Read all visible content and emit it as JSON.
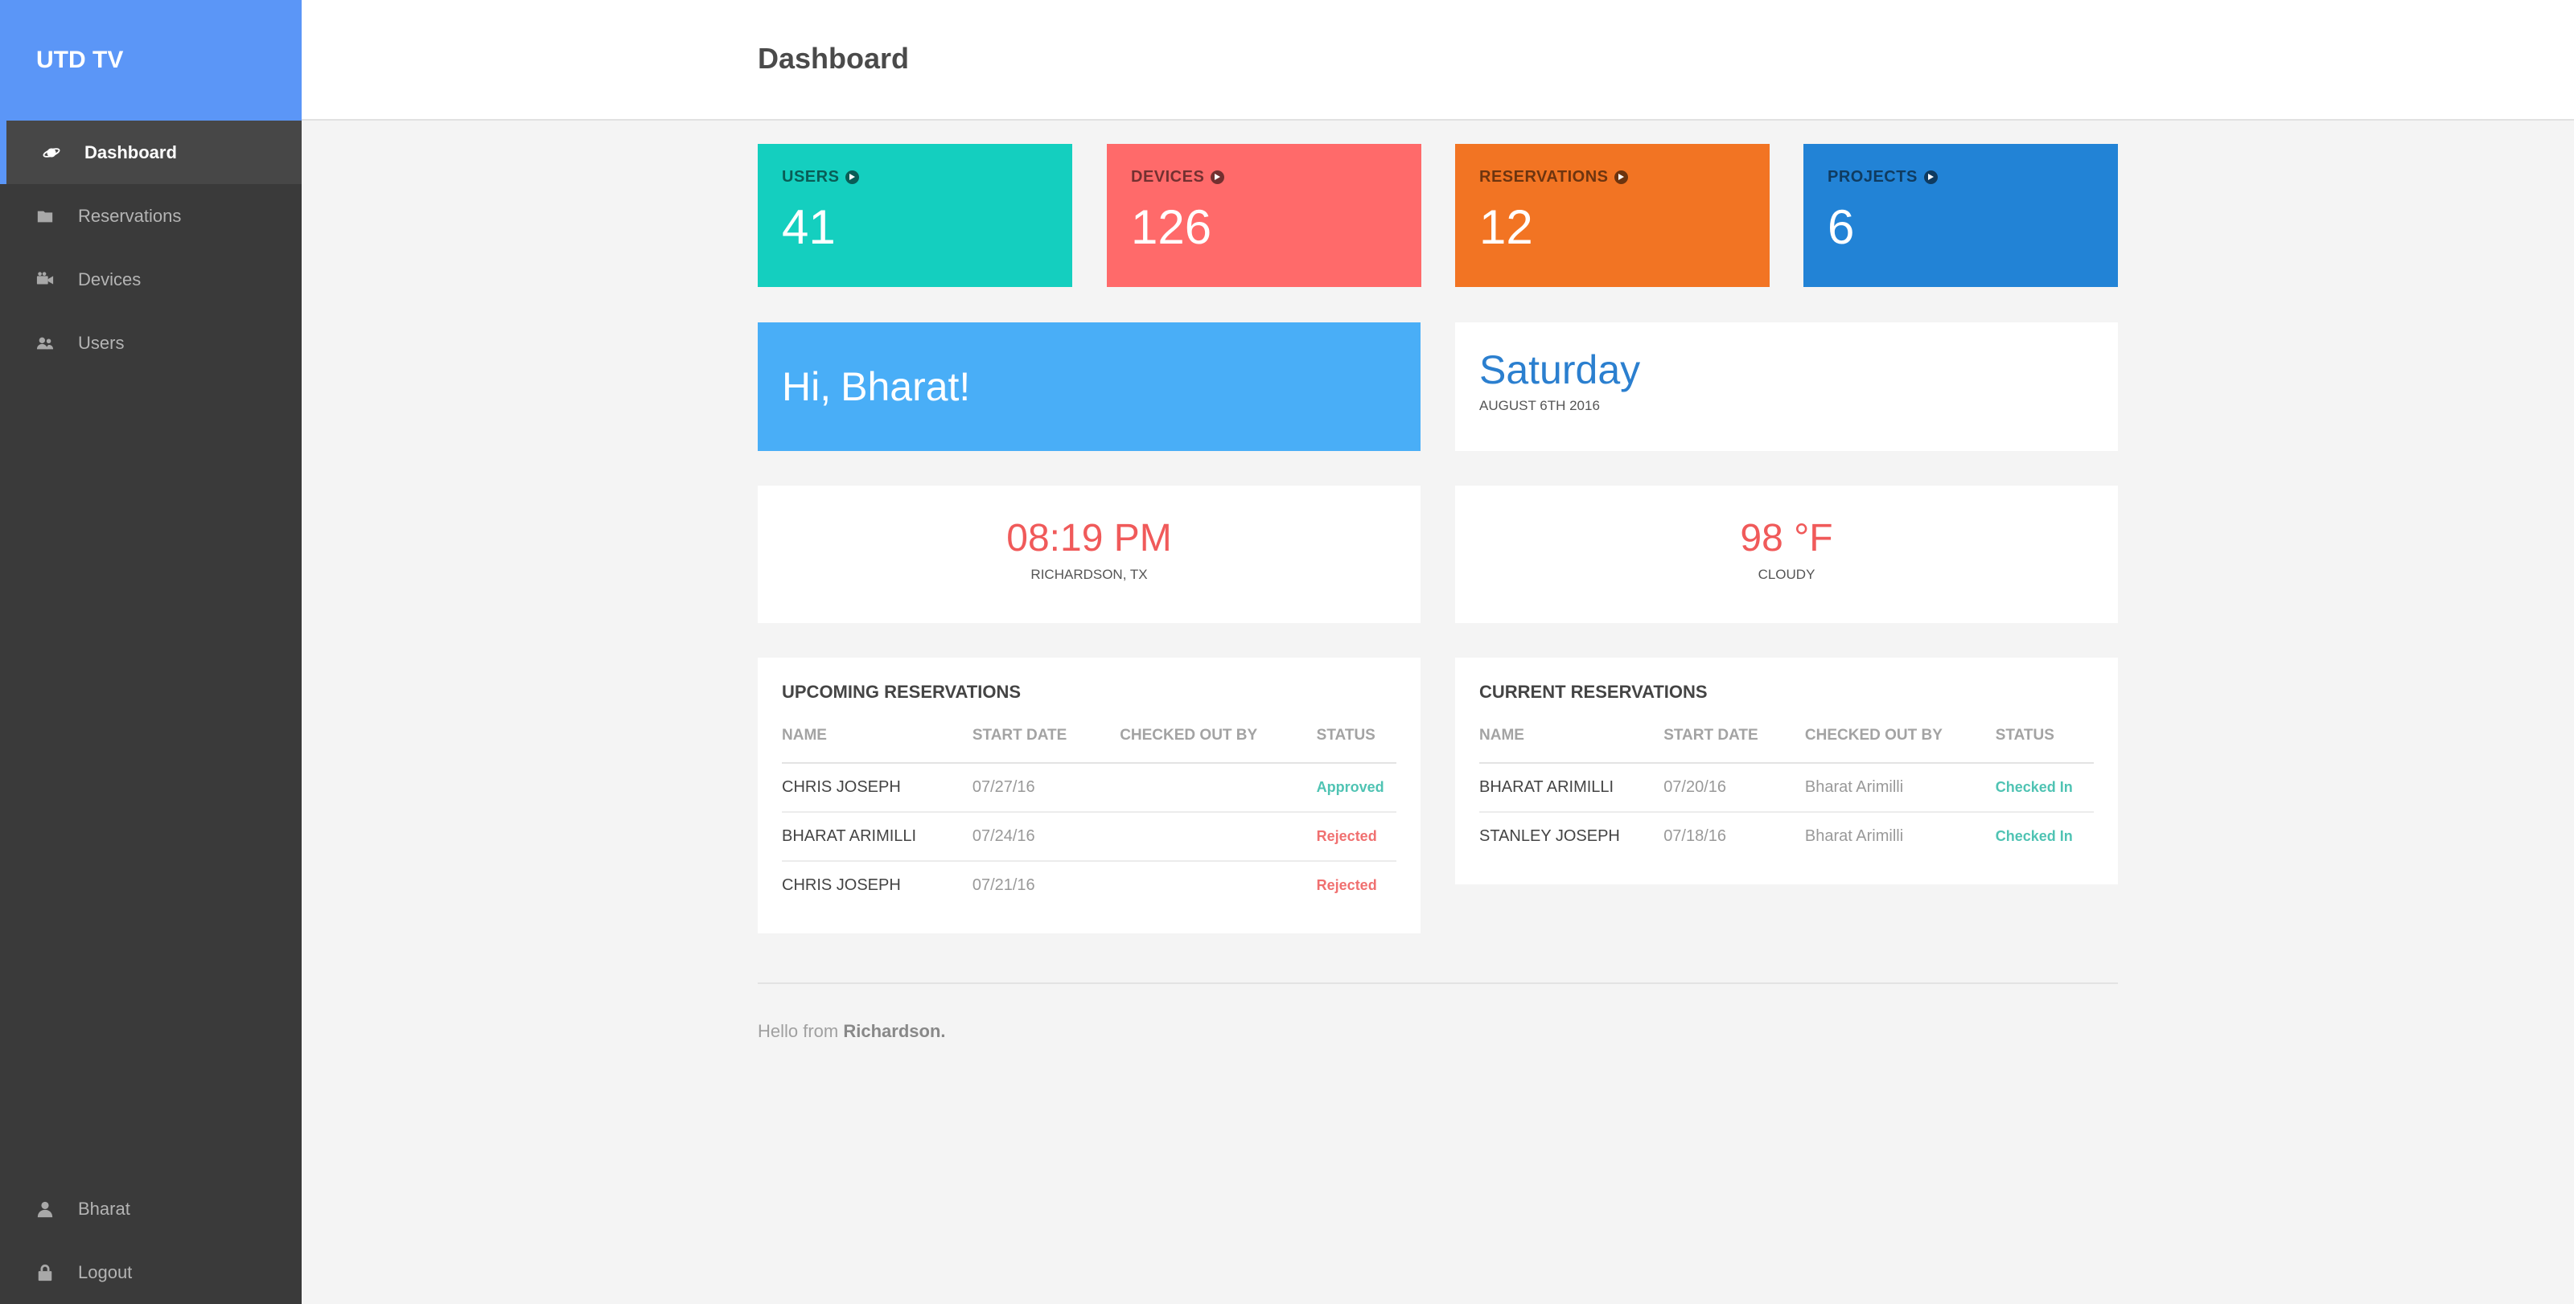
{
  "app": {
    "brand": "UTD TV"
  },
  "sidebar": {
    "items": [
      {
        "label": "Dashboard",
        "icon": "planet-icon",
        "active": true
      },
      {
        "label": "Reservations",
        "icon": "folder-icon",
        "active": false
      },
      {
        "label": "Devices",
        "icon": "video-camera-icon",
        "active": false
      },
      {
        "label": "Users",
        "icon": "users-icon",
        "active": false
      }
    ],
    "bottom": [
      {
        "label": "Bharat",
        "icon": "user-icon"
      },
      {
        "label": "Logout",
        "icon": "lock-icon"
      }
    ]
  },
  "header": {
    "title": "Dashboard"
  },
  "stats": [
    {
      "label": "USERS",
      "value": "41",
      "color": "#14cfbf"
    },
    {
      "label": "DEVICES",
      "value": "126",
      "color": "#ff6a6a"
    },
    {
      "label": "RESERVATIONS",
      "value": "12",
      "color": "#f27423"
    },
    {
      "label": "PROJECTS",
      "value": "6",
      "color": "#2283d6"
    }
  ],
  "greeting": {
    "prefix": "Hi,",
    "name": "Bharat!"
  },
  "day": {
    "weekday": "Saturday",
    "date": "AUGUST 6TH 2016"
  },
  "clock": {
    "time": "08:19 PM",
    "location": "RICHARDSON, TX"
  },
  "weather": {
    "temp": "98 °F",
    "condition": "CLOUDY"
  },
  "upcoming": {
    "title": "UPCOMING RESERVATIONS",
    "columns": [
      "NAME",
      "START DATE",
      "CHECKED OUT BY",
      "STATUS"
    ],
    "rows": [
      {
        "name": "CHRIS JOSEPH",
        "start": "07/27/16",
        "by": "",
        "status": "Approved",
        "status_color": "#4fc3b3"
      },
      {
        "name": "BHARAT ARIMILLI",
        "start": "07/24/16",
        "by": "",
        "status": "Rejected",
        "status_color": "#f07070"
      },
      {
        "name": "CHRIS JOSEPH",
        "start": "07/21/16",
        "by": "",
        "status": "Rejected",
        "status_color": "#f07070"
      }
    ]
  },
  "current": {
    "title": "CURRENT RESERVATIONS",
    "columns": [
      "NAME",
      "START DATE",
      "CHECKED OUT BY",
      "STATUS"
    ],
    "rows": [
      {
        "name": "BHARAT ARIMILLI",
        "start": "07/20/16",
        "by": "Bharat Arimilli",
        "status": "Checked In",
        "status_color": "#4fc3b3"
      },
      {
        "name": "STANLEY JOSEPH",
        "start": "07/18/16",
        "by": "Bharat Arimilli",
        "status": "Checked In",
        "status_color": "#4fc3b3"
      }
    ]
  },
  "footer": {
    "prefix": "Hello from",
    "place": "Richardson."
  }
}
